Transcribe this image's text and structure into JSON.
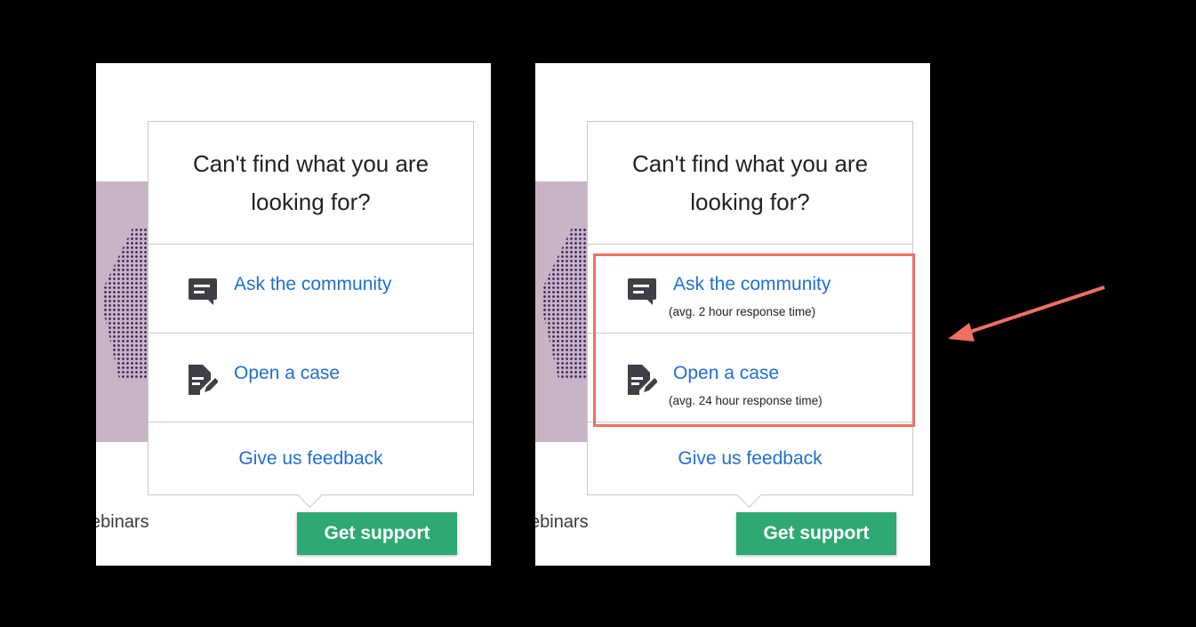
{
  "panels": [
    {
      "id": "before",
      "background_text": "ebinars",
      "popover": {
        "title": "Can't find what you are looking for?",
        "items": [
          {
            "label": "Ask the community",
            "icon": "chat-icon"
          },
          {
            "label": "Open a case",
            "icon": "document-edit-icon"
          }
        ],
        "feedback_label": "Give us feedback"
      },
      "support_button_label": "Get support"
    },
    {
      "id": "after",
      "background_text": "ebinars",
      "popover": {
        "title": "Can't find what you are looking for?",
        "items": [
          {
            "label": "Ask the community",
            "subtext": "(avg. 2 hour response time)",
            "icon": "chat-icon"
          },
          {
            "label": "Open a case",
            "subtext": "(avg. 24 hour response time)",
            "icon": "document-edit-icon"
          }
        ],
        "feedback_label": "Give us feedback"
      },
      "support_button_label": "Get support"
    }
  ],
  "colors": {
    "link": "#1f6fd1",
    "button": "#2ea974",
    "highlight": "#f07060",
    "art_background": "#c9b3c7"
  }
}
